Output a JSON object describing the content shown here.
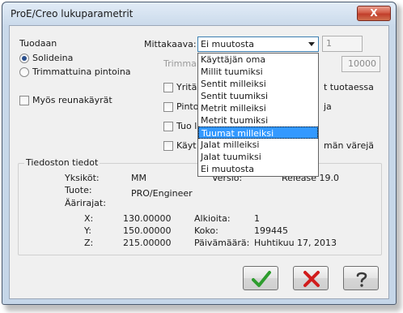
{
  "window": {
    "title": "ProE/Creo lukuparametrit",
    "close_label": "X"
  },
  "import_group": {
    "label": "Tuodaan",
    "option_solids": "Solideina",
    "option_surfaces": "Trimmattuina pintoina",
    "checkbox_edges": "Myös reunakäyrät"
  },
  "scale": {
    "label": "Mittakaava:",
    "selected": "Ei muutosta",
    "factor": "1",
    "trim_label": "Trimma",
    "trim_value": "10000"
  },
  "dropdown_options": [
    "Käyttäjän oma",
    "Millit tuumiksi",
    "Sentit milleiksi",
    "Sentit tuumiksi",
    "Metrit milleiksi",
    "Metrit tuumiksi",
    "Tuumat milleiksi",
    "Jalat milleiksi",
    "Jalat tuumiksi",
    "Ei muutosta"
  ],
  "dropdown_selected_index": 6,
  "options": {
    "opt1_left": "Yritä",
    "opt1_right": "t tuotaessa",
    "opt2_left": "Pinto",
    "opt2_right": "ja",
    "opt3_left": "Tuo l",
    "opt4_left": "Käyt",
    "opt4_right": "män värejä"
  },
  "file_info": {
    "title": "Tiedoston tiedot",
    "units_label": "Yksiköt:",
    "units_value": "MM",
    "product_label": "Tuote:",
    "product_value": "PRO/Engineer",
    "version_label": "Versio:",
    "version_value": "Release 19.0",
    "extents_label": "Äärirajat:",
    "x_label": "X:",
    "x_value": "130.00000",
    "y_label": "Y:",
    "y_value": "150.00000",
    "z_label": "Z:",
    "z_value": "215.00000",
    "elements_label": "Alkioita:",
    "elements_value": "1",
    "size_label": "Koko:",
    "size_value": "199445",
    "date_label": "Päivämäärä:",
    "date_value": "Huhtikuu 17, 2013"
  },
  "buttons": {
    "ok_icon": "checkmark-icon",
    "cancel_icon": "x-icon",
    "help_icon": "question-icon"
  },
  "colors": {
    "ok": "#2e9d2e",
    "cancel": "#d11c1c",
    "selection": "#3399ff"
  }
}
